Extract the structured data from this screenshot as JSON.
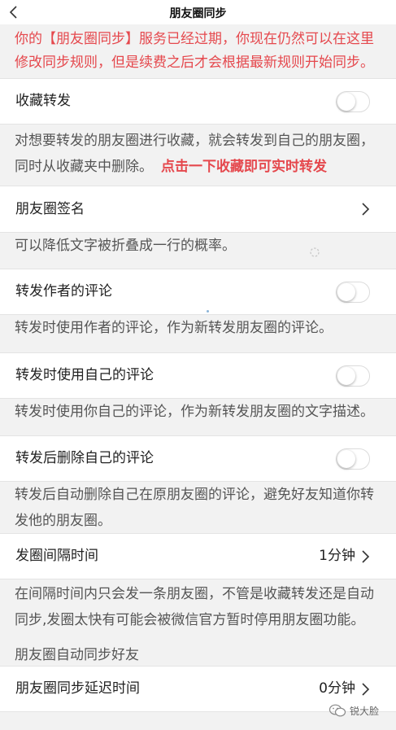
{
  "header": {
    "title": "朋友圈同步"
  },
  "notice": "你的【朋友圈同步】服务已经过期，你现在仍然可以在这里修改同步规则，但是续费之后才会根据最新规则开始同步。",
  "favorite_forward": {
    "label": "收藏转发",
    "enabled": false,
    "desc": "对想要转发的朋友圈进行收藏，就会转发到自己的朋友圈，同时从收藏夹中删除。",
    "desc_highlight": "点击一下收藏即可实时转发"
  },
  "signature": {
    "label": "朋友圈签名",
    "desc": "可以降低文字被折叠成一行的概率。"
  },
  "author_comment": {
    "label": "转发作者的评论",
    "enabled": false,
    "desc": "转发时使用作者的评论，作为新转发朋友圈的评论。"
  },
  "own_comment": {
    "label": "转发时使用自己的评论",
    "enabled": false,
    "desc": "转发时使用你自己的评论，作为新转发朋友圈的文字描述。"
  },
  "delete_own_comment": {
    "label": "转发后删除自己的评论",
    "enabled": false,
    "desc": "转发后自动删除自己在原朋友圈的评论，避免好友知道你转发他的朋友圈。"
  },
  "interval": {
    "label": "发圈间隔时间",
    "value": "1分钟",
    "desc": "在间隔时间内只会发一条朋友圈，不管是收藏转发还是自动同步,发圈太快有可能会被微信官方暂时停用朋友圈功能。"
  },
  "auto_sync_section": "朋友圈自动同步好友",
  "delay": {
    "label": "朋友圈同步延迟时间",
    "value": "0分钟"
  },
  "watermark": "锐大脸",
  "colors": {
    "accent_red": "#e5484d",
    "toggle_off_border": "#dcdcdc"
  }
}
